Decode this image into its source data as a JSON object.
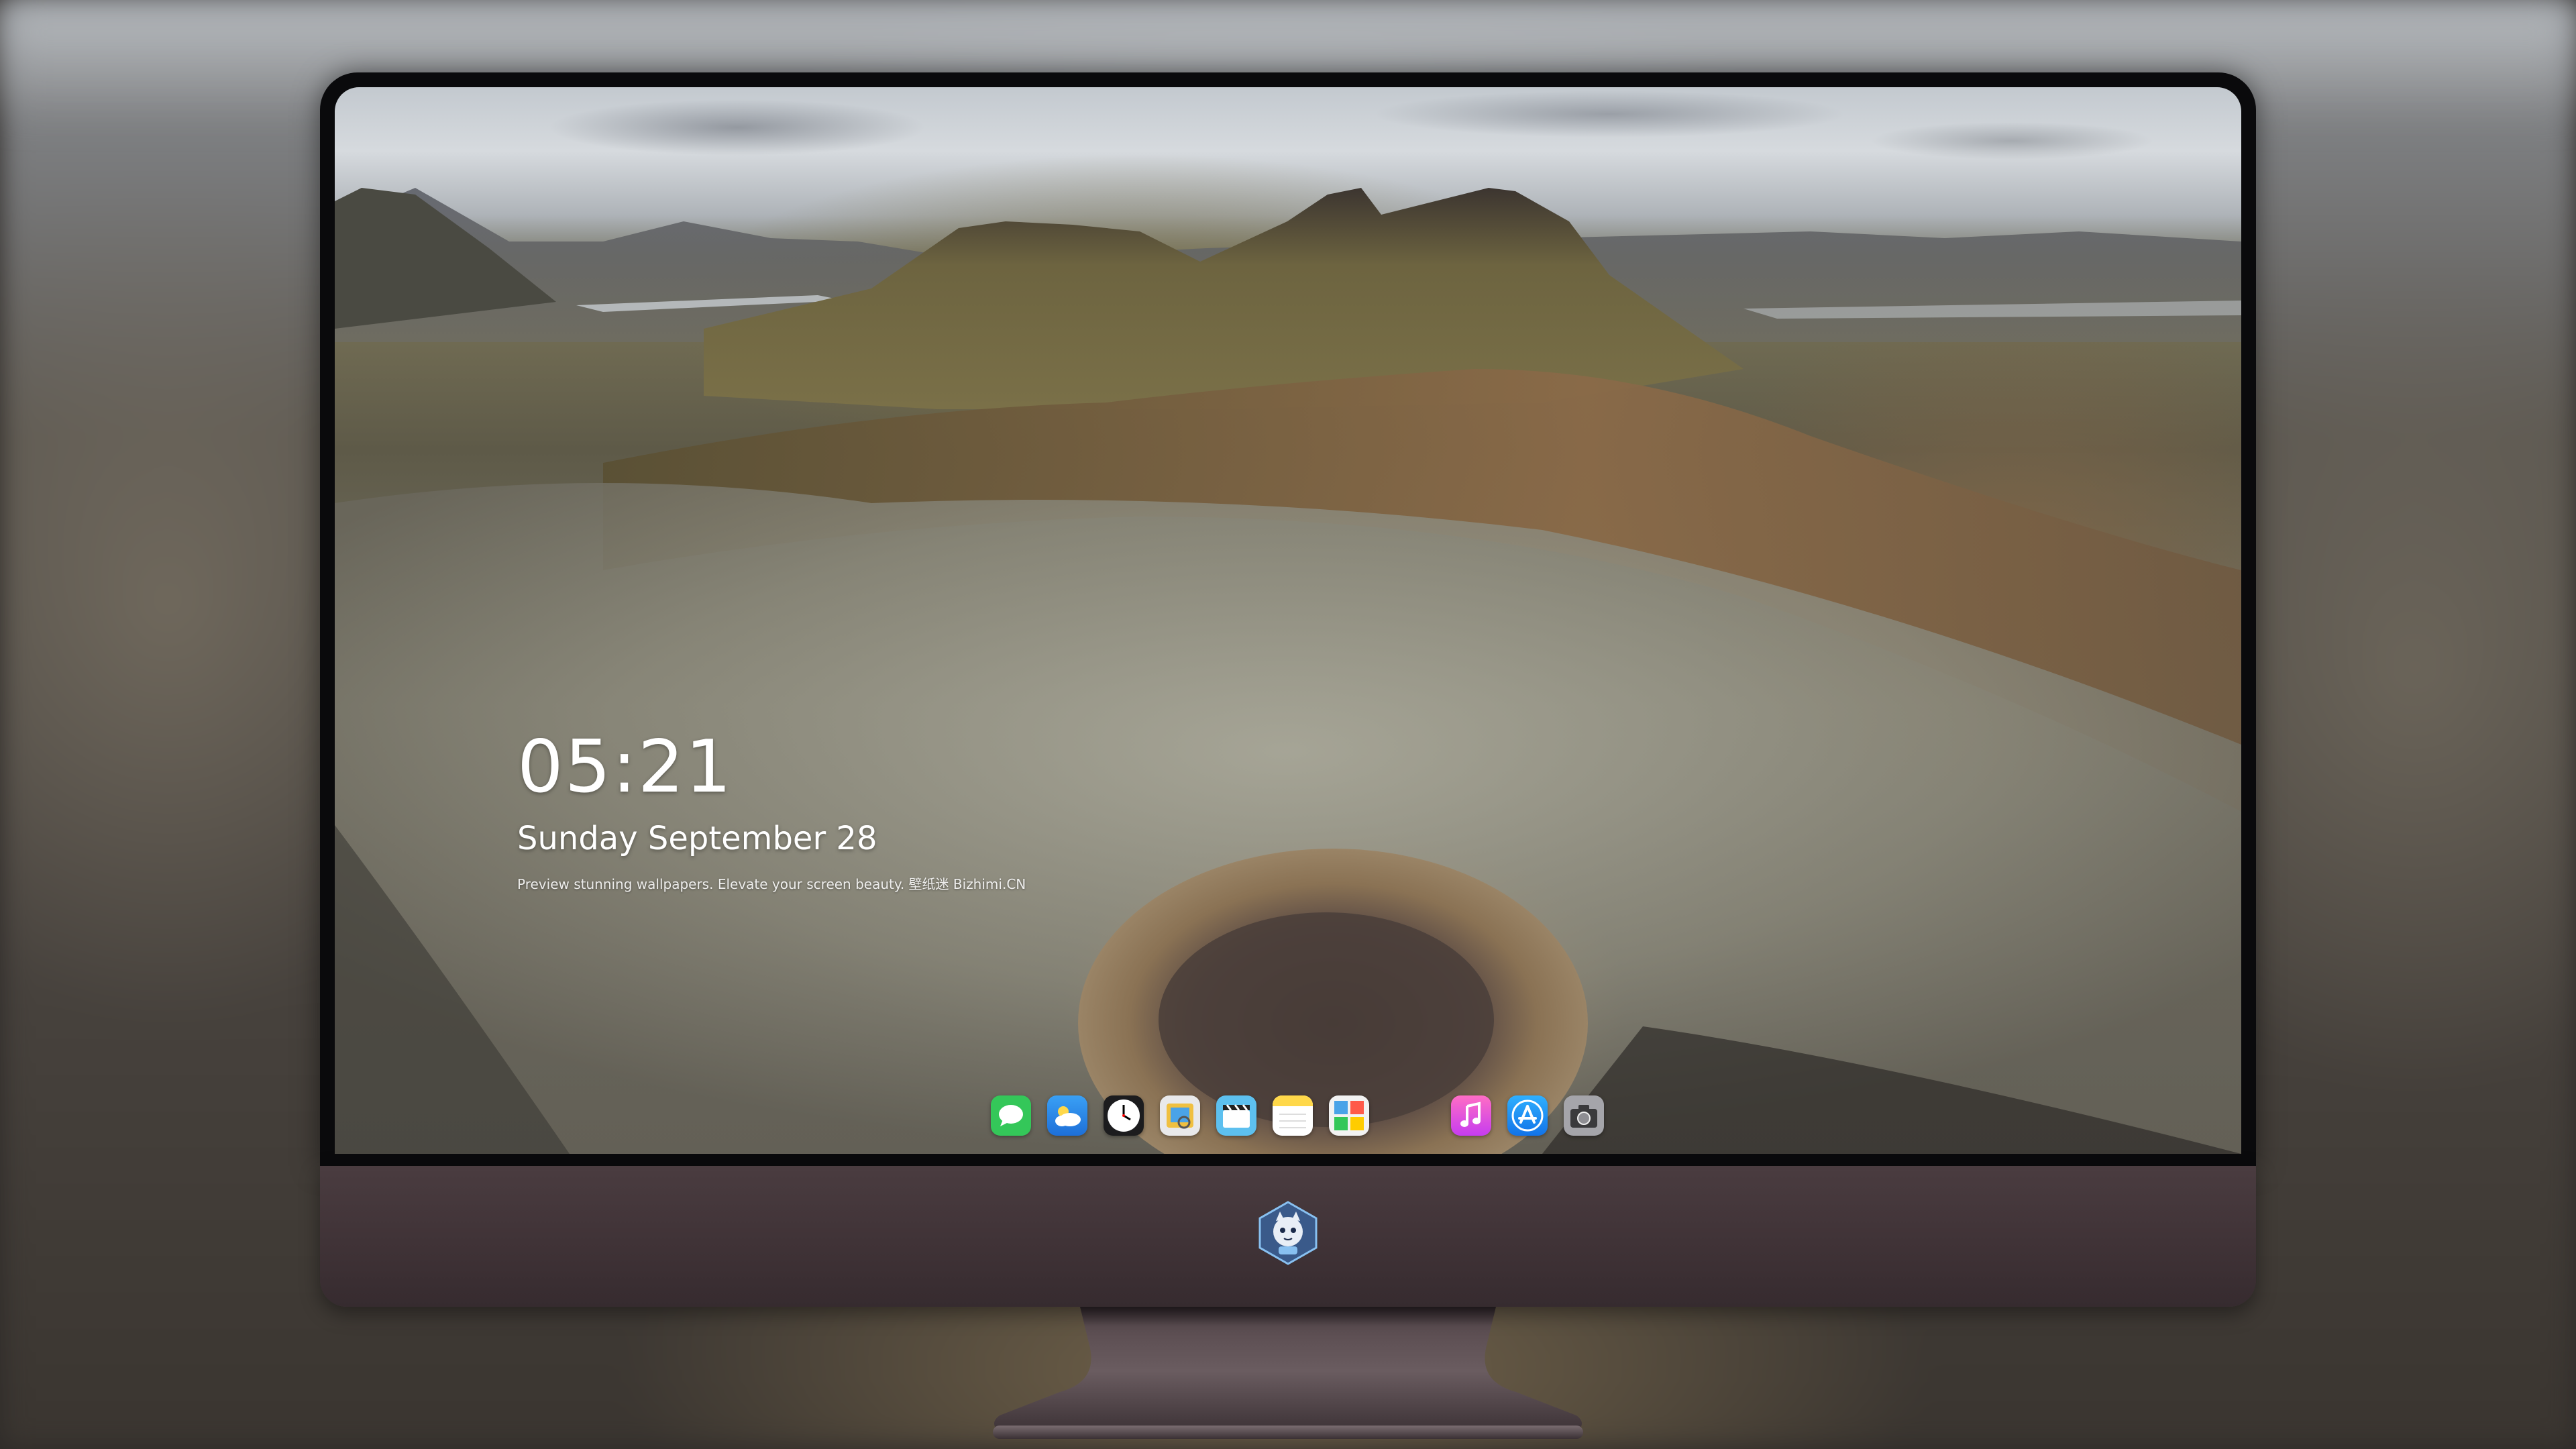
{
  "lock_screen": {
    "time": "05:21",
    "date": "Sunday September 28",
    "tagline": "Preview stunning wallpapers. Elevate your screen beauty. 壁纸迷  Bizhimi.CN"
  },
  "dock": {
    "apps": [
      {
        "name": "Messages",
        "icon": "messages-icon",
        "color": "#34c759"
      },
      {
        "name": "Weather",
        "icon": "weather-icon",
        "color": "#2b8cf0"
      },
      {
        "name": "Clock",
        "icon": "clock-icon",
        "color": "#ffffff"
      },
      {
        "name": "Preview",
        "icon": "preview-icon",
        "color": "#f0c040"
      },
      {
        "name": "Clips",
        "icon": "clips-icon",
        "color": "#4fb6e8"
      },
      {
        "name": "Notes",
        "icon": "notes-icon",
        "color": "#ffd84a"
      },
      {
        "name": "Photos Board",
        "icon": "board-icon",
        "color": "#e8e8e8"
      },
      {
        "name": "Music",
        "icon": "music-icon",
        "color": "#ff4fa8"
      },
      {
        "name": "App Store",
        "icon": "app-store-icon",
        "color": "#1a8cff"
      },
      {
        "name": "Camera",
        "icon": "camera-icon",
        "color": "#8e8e93"
      }
    ]
  },
  "colors": {
    "bezel": "#0a0a0c",
    "chin": "#3f3236",
    "stand": "#4a4044"
  }
}
